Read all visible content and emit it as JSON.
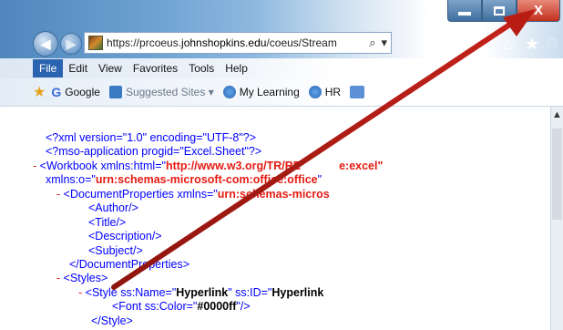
{
  "window": {
    "min_label": "–",
    "close_label": "X"
  },
  "nav": {
    "url_scheme": "https://prcoeus.",
    "url_domain": "johnshopkins.edu",
    "url_path": "/coeus/Stream",
    "search_glyph": "⌕",
    "dropdown_glyph": "▾"
  },
  "menubar": {
    "items": [
      "File",
      "Edit",
      "View",
      "Favorites",
      "Tools",
      "Help"
    ]
  },
  "favbar": {
    "google": "Google",
    "suggested": "Suggested Sites",
    "suggested_arrow": "▾",
    "mylearning": "My Learning",
    "hr": "HR"
  },
  "xml": {
    "l1": "<?xml version=\"1.0\" encoding=\"UTF-8\"?>",
    "l2": "<?mso-application progid=\"Excel.Sheet\"?>",
    "l3_minus": "-",
    "l3_a": "<Workbook xmlns:html=\"",
    "l3_b": "http://www.w3.org/TR/RE",
    "l3_c": "e:excel\"",
    "l4_a": "xmlns:o=\"",
    "l4_b": "urn:schemas-microsoft-com:office:office",
    "l4_c": "\"",
    "l5_minus": "-",
    "l5_a": "<DocumentProperties xmlns=\"",
    "l5_b": "urn:schemas-micros",
    "l6": "<Author/>",
    "l7": "<Title/>",
    "l8": "<Description/>",
    "l9": "<Subject/>",
    "l10": "</DocumentProperties>",
    "l11_minus": "-",
    "l11": "<Styles>",
    "l12_minus": "-",
    "l12_a": "<Style ss:Name=\"",
    "l12_b": "Hyperlink",
    "l12_c": "\" ss:ID=\"",
    "l12_d": "Hyperlink",
    "l13_a": "<Font ss:Color=\"",
    "l13_b": "#0000ff",
    "l13_c": "\"/>",
    "l14": "</Style>"
  },
  "colors": {
    "arrow": "#b81d13",
    "xml_tag": "#0000ff",
    "xml_value": "#e41b13"
  }
}
